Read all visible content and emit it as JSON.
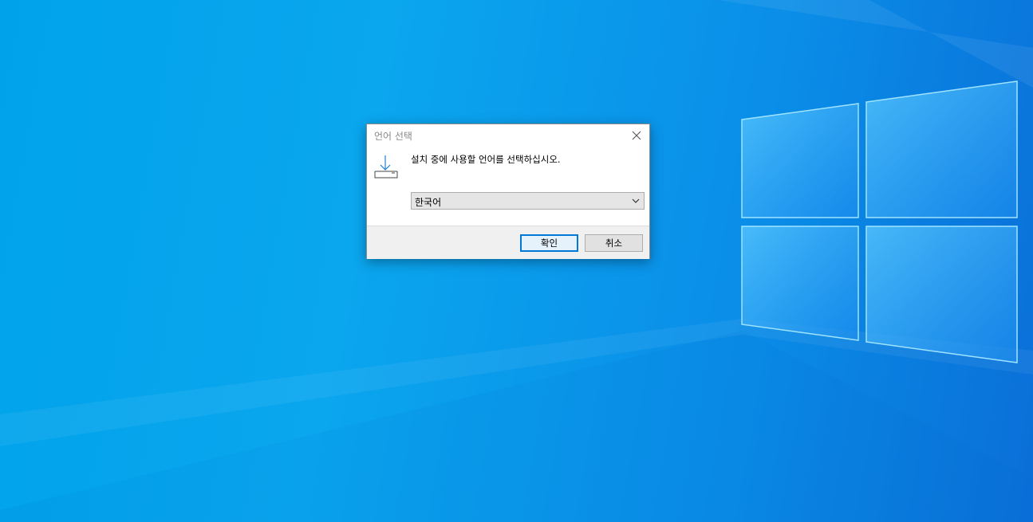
{
  "dialog": {
    "title": "언어 선택",
    "message": "설치 중에 사용할 언어를 선택하십시오.",
    "language_select": {
      "selected": "한국어"
    },
    "ok_label": "확인",
    "cancel_label": "취소"
  },
  "icons": {
    "close": "close-icon",
    "install": "install-download-icon",
    "dropdown": "chevron-down-icon"
  },
  "colors": {
    "desktop_bg": "#00a3ea",
    "accent": "#0078d7",
    "footer_bg": "#f0f0f0",
    "title_text": "#8a8a8a"
  }
}
